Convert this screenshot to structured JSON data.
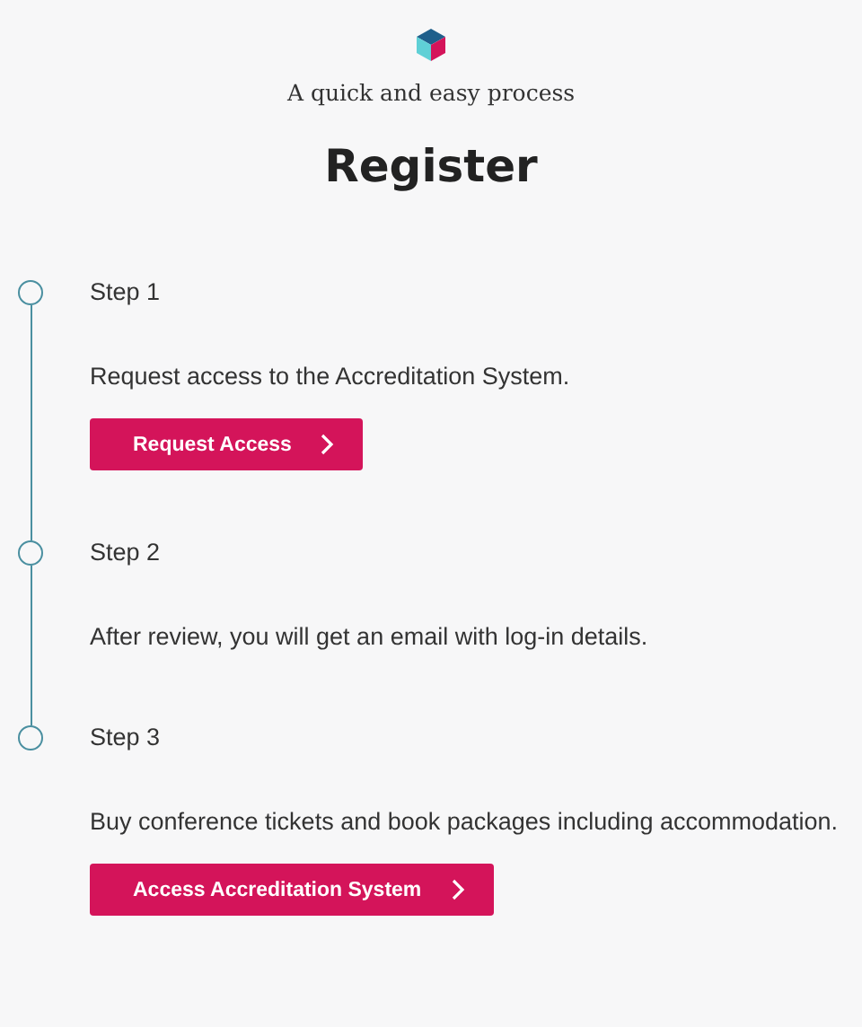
{
  "header": {
    "subtitle": "A quick and easy process",
    "title": "Register"
  },
  "steps": [
    {
      "title": "Step 1",
      "description": "Request access to the Accreditation System.",
      "button": "Request Access"
    },
    {
      "title": "Step 2",
      "description": "After review, you will get an email with log-in details."
    },
    {
      "title": "Step 3",
      "description": "Buy conference tickets and book packages including accommodation.",
      "button": "Access Accreditation System"
    }
  ]
}
